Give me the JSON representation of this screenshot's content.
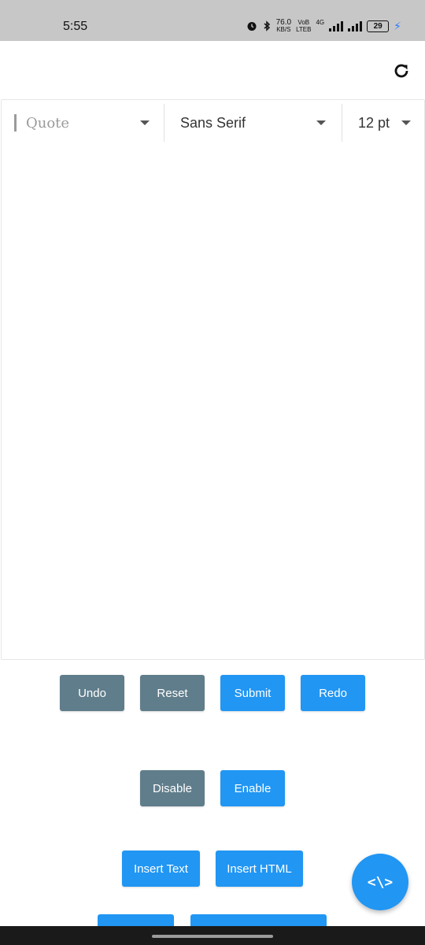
{
  "status_bar": {
    "time": "5:55",
    "speed_value": "76.0",
    "speed_unit": "KB/S",
    "net_top": "VoB",
    "net_bottom": "LTEB",
    "network_type": "4G",
    "battery": "29",
    "icons": [
      "alarm-icon",
      "bluetooth-icon",
      "signal-icon",
      "signal-icon",
      "battery-icon",
      "charging-icon"
    ]
  },
  "toolbar": {
    "style_dropdown": "Quote",
    "font_dropdown": "Sans Serif",
    "size_dropdown": "12 pt"
  },
  "buttons": {
    "undo": "Undo",
    "reset": "Reset",
    "submit": "Submit",
    "redo": "Redo",
    "disable": "Disable",
    "enable": "Enable",
    "insert_text": "Insert Text",
    "insert_html": "Insert HTML"
  },
  "fab": {
    "label": "<\\>"
  },
  "colors": {
    "primary": "#2196f3",
    "secondary": "#607d8b",
    "status_bar": "#c7c7c7"
  }
}
